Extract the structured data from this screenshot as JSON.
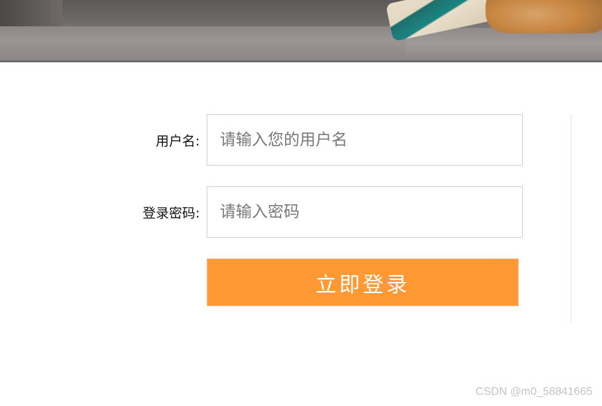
{
  "banner": {
    "image": "sofa-photo"
  },
  "form": {
    "username_label": "用户名:",
    "username_placeholder": "请输入您的用户名",
    "username_value": "",
    "password_label": "登录密码:",
    "password_placeholder": "请输入密码",
    "password_value": "",
    "login_button_label": "立即登录"
  },
  "colors": {
    "button_background": "#ff9933",
    "button_text": "#ffffff",
    "input_border": "#cfcfcf"
  },
  "watermark": "CSDN @m0_58841665"
}
